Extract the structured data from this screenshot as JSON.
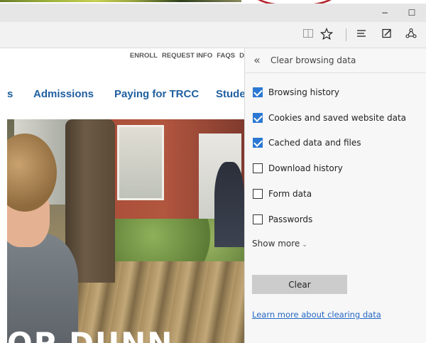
{
  "browser": {
    "window_controls": {
      "minimize": "−",
      "maximize": "☐"
    },
    "toolbar_icons": [
      "reading-view-icon",
      "favorites-star-icon",
      "hub-icon",
      "web-note-icon",
      "share-icon"
    ]
  },
  "website": {
    "top_links": [
      "ENROLL",
      "REQUEST INFO",
      "FAQS",
      "D"
    ],
    "nav": [
      "s",
      "Admissions",
      "Paying for TRCC",
      "Stude"
    ],
    "hero_text": "OP DUNN"
  },
  "panel": {
    "back_icon": "«",
    "title": "Clear browsing data",
    "options": [
      {
        "label": "Browsing history",
        "checked": true
      },
      {
        "label": "Cookies and saved website data",
        "checked": true
      },
      {
        "label": "Cached data and files",
        "checked": true
      },
      {
        "label": "Download history",
        "checked": false
      },
      {
        "label": "Form data",
        "checked": false
      },
      {
        "label": "Passwords",
        "checked": false
      }
    ],
    "show_more": "Show more",
    "clear_button": "Clear",
    "learn_more": "Learn more about clearing data"
  },
  "colors": {
    "accent": "#2a78d3",
    "nav_link": "#1f5f9f",
    "panel_bg": "#f7f7f7"
  }
}
